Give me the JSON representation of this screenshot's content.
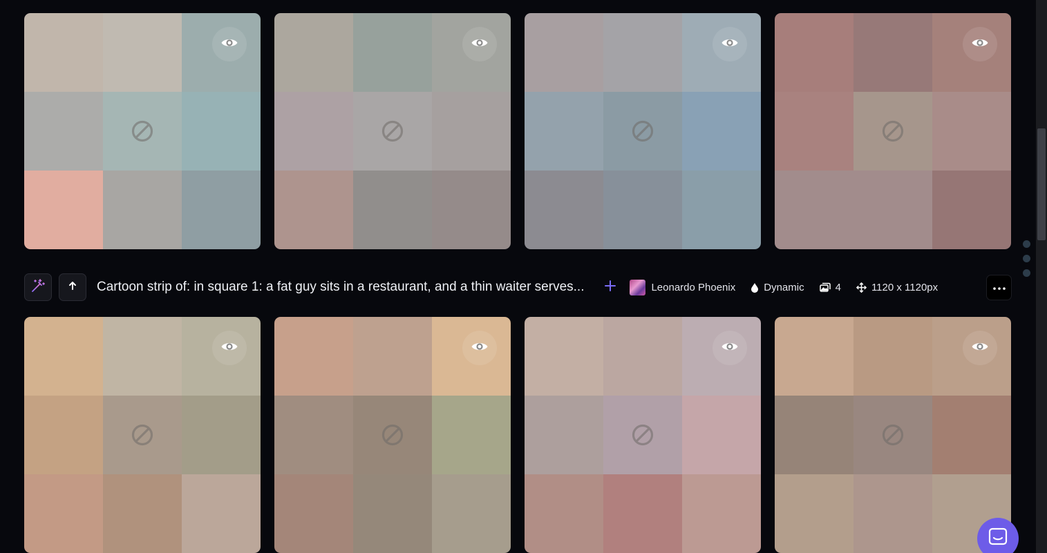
{
  "top_row": [
    {
      "cells": [
        "#c1b6ab",
        "#c0bab1",
        "#9cadad",
        "#acacaa",
        "#a5b6b4",
        "#97b2b5",
        "#e1ada0",
        "#a8a6a3",
        "#8f9ea3"
      ]
    },
    {
      "cells": [
        "#aca79e",
        "#97a19c",
        "#a2a49f",
        "#ada1a4",
        "#a9a6a6",
        "#a6a09f",
        "#ae948e",
        "#918e8c",
        "#958b8a"
      ]
    },
    {
      "cells": [
        "#a89fa1",
        "#a4a3a7",
        "#9eacb5",
        "#94a2ac",
        "#8b9ba4",
        "#89a1b5",
        "#8c8b91",
        "#87909a",
        "#8a9ea9"
      ]
    },
    {
      "cells": [
        "#a77e7b",
        "#977978",
        "#a5817b",
        "#a9827f",
        "#a6968c",
        "#a98c89",
        "#a28c8c",
        "#a28c8c",
        "#967675"
      ]
    }
  ],
  "bottom_row": [
    {
      "cells": [
        "#d3b28f",
        "#c0b5a4",
        "#b7b29f",
        "#c4a283",
        "#a99a8c",
        "#a39d89",
        "#c39a85",
        "#b0927d",
        "#bba79a"
      ]
    },
    {
      "cells": [
        "#c7a08b",
        "#bea18f",
        "#dab894",
        "#a08d80",
        "#978779",
        "#a6a68a",
        "#a48679",
        "#95887a",
        "#a69d8d"
      ]
    },
    {
      "cells": [
        "#c3afa4",
        "#bba7a1",
        "#bcadb2",
        "#ad9f9d",
        "#b1a0a8",
        "#c5a6a9",
        "#b18e86",
        "#b1807e",
        "#bc9a93"
      ]
    },
    {
      "cells": [
        "#c8a890",
        "#b99a83",
        "#bb9f8a",
        "#968478",
        "#998780",
        "#a37f71",
        "#b39e8c",
        "#ad968d",
        "#b19f8f"
      ]
    }
  ],
  "generation": {
    "prompt": "Cartoon strip of: in square 1: a fat guy sits in a restaurant, and a thin waiter serves...",
    "model": "Leonardo Phoenix",
    "style": "Dynamic",
    "image_count": "4",
    "dimensions": "1120 x 1120px"
  },
  "icons": {
    "tile_view": "eye-icon",
    "tile_blocked": "blocked-icon",
    "remix": "magic-wand-icon",
    "upscale": "arrow-up-icon",
    "add": "plus-icon",
    "style": "droplet-icon",
    "count": "images-icon",
    "size": "move-arrows-icon",
    "more": "ellipsis-icon",
    "chat": "chat-icon"
  },
  "colors": {
    "background": "#07080d",
    "accent": "#6d5ce8",
    "plus": "#7b6cf6"
  }
}
